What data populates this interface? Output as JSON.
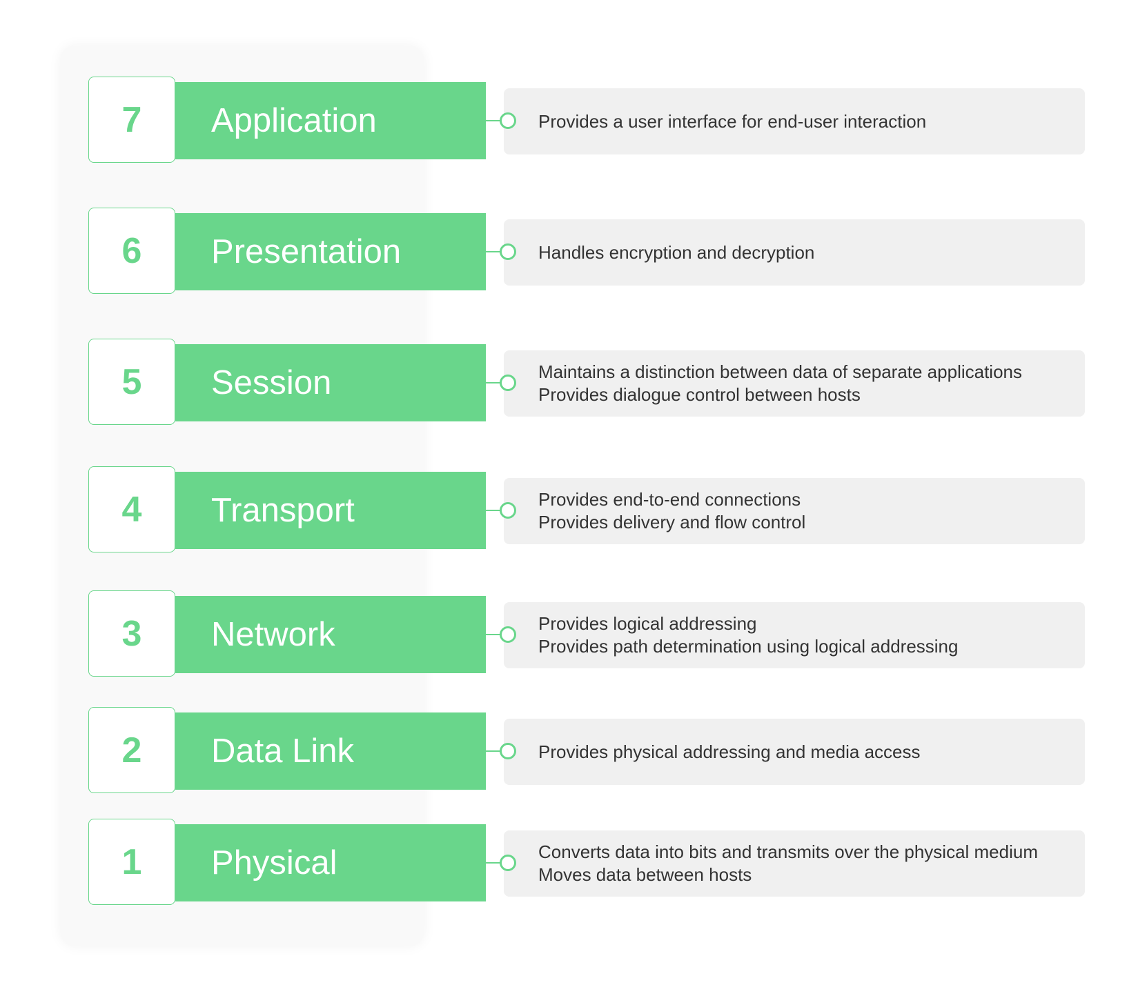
{
  "colors": {
    "accent": "#69D68B",
    "description_bg": "#F0F0F0",
    "text": "#333333"
  },
  "layers": [
    {
      "number": "7",
      "name": "Application",
      "lines": [
        "Provides a user interface for end-user interaction"
      ]
    },
    {
      "number": "6",
      "name": "Presentation",
      "lines": [
        "Handles encryption and decryption"
      ]
    },
    {
      "number": "5",
      "name": "Session",
      "lines": [
        "Maintains a distinction between data of separate applications",
        "Provides dialogue control between hosts"
      ]
    },
    {
      "number": "4",
      "name": "Transport",
      "lines": [
        "Provides end-to-end connections",
        "Provides delivery and flow control"
      ]
    },
    {
      "number": "3",
      "name": "Network",
      "lines": [
        "Provides logical addressing",
        "Provides path determination using logical addressing"
      ]
    },
    {
      "number": "2",
      "name": "Data Link",
      "lines": [
        "Provides physical addressing and media access"
      ]
    },
    {
      "number": "1",
      "name": "Physical",
      "lines": [
        "Converts data into bits and transmits over the physical medium",
        "Moves data between hosts"
      ]
    }
  ]
}
